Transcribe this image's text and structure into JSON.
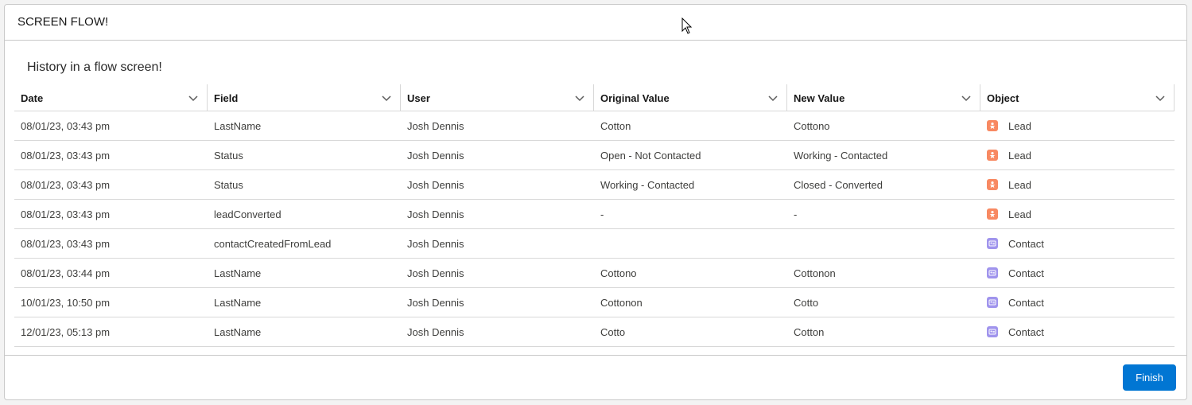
{
  "header": {
    "title": "SCREEN FLOW!"
  },
  "subtitle": "History in a flow screen!",
  "table": {
    "columns": [
      "Date",
      "Field",
      "User",
      "Original Value",
      "New Value",
      "Object"
    ],
    "rows": [
      {
        "date": "08/01/23, 03:43 pm",
        "field": "LastName",
        "user": "Josh Dennis",
        "original": "Cotton",
        "new": "Cottono",
        "object": "Lead"
      },
      {
        "date": "08/01/23, 03:43 pm",
        "field": "Status",
        "user": "Josh Dennis",
        "original": "Open - Not Contacted",
        "new": "Working - Contacted",
        "object": "Lead"
      },
      {
        "date": "08/01/23, 03:43 pm",
        "field": "Status",
        "user": "Josh Dennis",
        "original": "Working - Contacted",
        "new": "Closed - Converted",
        "object": "Lead"
      },
      {
        "date": "08/01/23, 03:43 pm",
        "field": "leadConverted",
        "user": "Josh Dennis",
        "original": "-",
        "new": "-",
        "object": "Lead"
      },
      {
        "date": "08/01/23, 03:43 pm",
        "field": "contactCreatedFromLead",
        "user": "Josh Dennis",
        "original": "",
        "new": "",
        "object": "Contact"
      },
      {
        "date": "08/01/23, 03:44 pm",
        "field": "LastName",
        "user": "Josh Dennis",
        "original": "Cottono",
        "new": "Cottonon",
        "object": "Contact"
      },
      {
        "date": "10/01/23, 10:50 pm",
        "field": "LastName",
        "user": "Josh Dennis",
        "original": "Cottonon",
        "new": "Cotto",
        "object": "Contact"
      },
      {
        "date": "12/01/23, 05:13 pm",
        "field": "LastName",
        "user": "Josh Dennis",
        "original": "Cotto",
        "new": "Cotton",
        "object": "Contact"
      }
    ]
  },
  "icons": {
    "column_menu": "chevron-down-icon",
    "lead": "lead-icon",
    "contact": "contact-icon",
    "cursor": "mouse-pointer-icon"
  },
  "colors": {
    "lead_icon": "#f88962",
    "contact_icon": "#a094ed",
    "finish_button": "#0176d3"
  },
  "footer": {
    "finish_label": "Finish"
  }
}
